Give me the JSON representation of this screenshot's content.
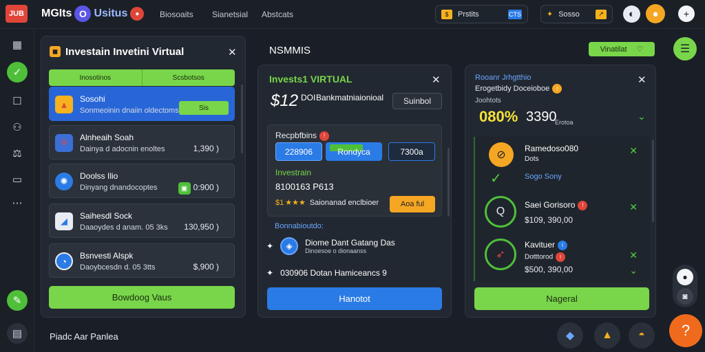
{
  "topbar": {
    "logo": "JUB",
    "brand_part1": "MGIts",
    "brand_mid": "O",
    "brand_part2": "Usitus",
    "nav": [
      "Biosoaits",
      "Sianetsial",
      "Abstcats"
    ],
    "pill1_label": "Prstits",
    "pill1_badge": "CTS",
    "pill2_label": "Sosso"
  },
  "sidebar": {
    "icons": [
      "grid-icon",
      "check-icon",
      "square-icon",
      "user-icon",
      "scales-icon",
      "monitor-icon",
      "more-icon",
      "wrench-icon",
      "document-icon"
    ]
  },
  "panel1": {
    "title": "Investain Invetini Virtual",
    "tabs": [
      "Inosotinos",
      "Scsbotsos"
    ],
    "items": [
      {
        "name": "Sosohi",
        "sub": "Sonmeoinin dnaiin oldectoms",
        "value": "Sis",
        "style": "button"
      },
      {
        "name": "Alnheaih Soah",
        "sub": "Dainya d adocnin enoltes",
        "value": "1,390 )"
      },
      {
        "name": "Doolss Ilio",
        "sub": "Dinyang dnandocoptes",
        "value": "0:900 )"
      },
      {
        "name": "Saihesdl Sock",
        "sub": "Daaoydes d anam. 05 3ks",
        "value": "130,950 )"
      },
      {
        "name": "Bsnvesti Alspk",
        "sub": "Daoybcesdn d. 05 3tts",
        "value": "$,900 )"
      }
    ],
    "button": "Bowdoog Vaus",
    "footer": "Piadc Aar Panlea"
  },
  "panel2": {
    "heading": "NSMMIS",
    "title": "Invests1 VIRTUAL",
    "big_number": "$12",
    "big_label": "DOI",
    "sub_label": "Bankmatniaionioal",
    "btn": "Suinbol",
    "card_title": "Recpbfbins",
    "chips": [
      "228906",
      "Rondyca",
      "7300a"
    ],
    "inv_label": "Investrain",
    "inv_value": "8100163 P613",
    "stars_prefix": "$1",
    "stars": "★★★",
    "stars_text": "Saionanad enclbioer",
    "orange_btn": "Aoa ful",
    "section": "Bonnabioutdo:",
    "row1_main": "Diome Dant Gatang Das",
    "row1_sub": "Dinoesoe o dionaanss",
    "row2": "030906 Dotan Hamiceancs 9",
    "button": "Hanotot"
  },
  "panel3": {
    "header_btn": "Vinatilat",
    "title": "Rooanr Jrhgtthio",
    "subtitle": "Erogetbidy Doceioboe",
    "small": "Joohtots",
    "big_pct": "080%",
    "big_num": "3390",
    "big_label": "Erotoa",
    "entries": [
      {
        "name": "Ramedoso080",
        "sub1": "Dots",
        "sub2": "Sogo Sony"
      },
      {
        "name": "Saei Gorisoro",
        "sub1": "$109, 390,00"
      },
      {
        "name": "Kavituer",
        "sub1": "Dotttorod",
        "sub2": "$500, 390,00"
      }
    ],
    "button": "Nageral"
  },
  "colors": {
    "accent_green": "#79d64a",
    "accent_blue": "#2b7be6",
    "accent_orange": "#f5a623",
    "danger": "#e0453a"
  }
}
